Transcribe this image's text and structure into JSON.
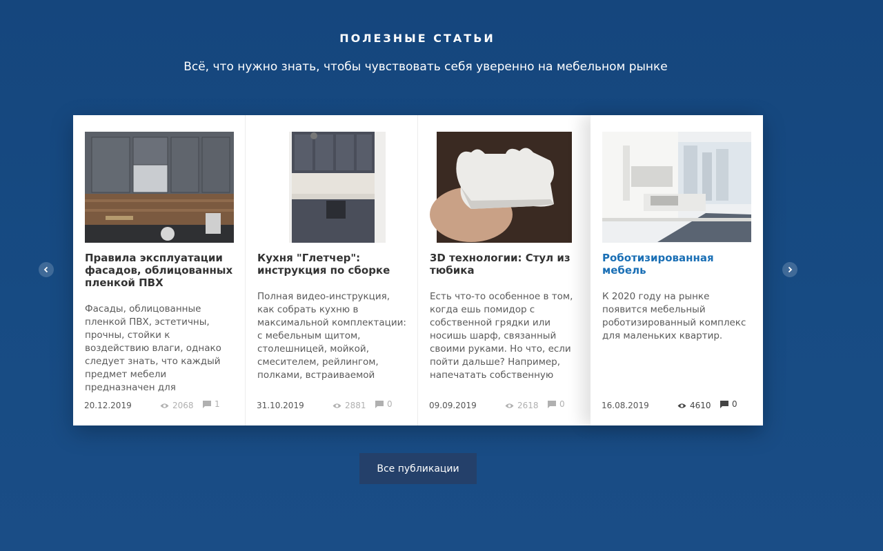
{
  "section": {
    "title": "ПОЛЕЗНЫЕ СТАТЬИ",
    "subtitle": "Всё, что нужно знать, чтобы чувствовать себя уверенно на мебельном рынке"
  },
  "articles": [
    {
      "title": "Правила эксплуатации фасадов, облицованных пленкой ПВХ",
      "excerpt": "Фасады, облицованные пленкой ПВХ, эстетичны, прочны, стойки к воздействию влаги, однако следует знать, что каждый предмет мебели предназначен для определенной цели, поэтому",
      "date": "20.12.2019",
      "views": "2068",
      "comments": "1",
      "image_icon": "kitchen-photo"
    },
    {
      "title": "Кухня \"Глетчер\": инструкция по сборке",
      "excerpt": "Полная видео-инструкция, как собрать кухню в максимальной комплектации: с мебельным щитом, столешницей, мойкой, смесителем, рейлингом, полками, встраиваемой",
      "date": "31.10.2019",
      "views": "2881",
      "comments": "0",
      "image_icon": "kitchen-photo"
    },
    {
      "title": "3D технологии: Стул из тюбика",
      "excerpt": "Есть что-то особенное в том, когда ешь помидор с собственной грядки или носишь шарф, связанный своими руками. Но что, если пойти дальше? Например, напечатать собственную",
      "date": "09.09.2019",
      "views": "2618",
      "comments": "0",
      "image_icon": "3d-print-photo"
    },
    {
      "title": "Роботизированная мебель",
      "excerpt": "К 2020 году на рынке появится мебельный роботизированный комплекс для маленьких квартир.",
      "date": "16.08.2019",
      "views": "4610",
      "comments": "0",
      "image_icon": "room-photo"
    }
  ],
  "navigation": {
    "prev_icon": "chevron-left-icon",
    "next_icon": "chevron-right-icon"
  },
  "all_button_label": "Все публикации",
  "colors": {
    "background": "#174a80",
    "accent_title": "#1a6fb5",
    "button": "#24406a"
  }
}
